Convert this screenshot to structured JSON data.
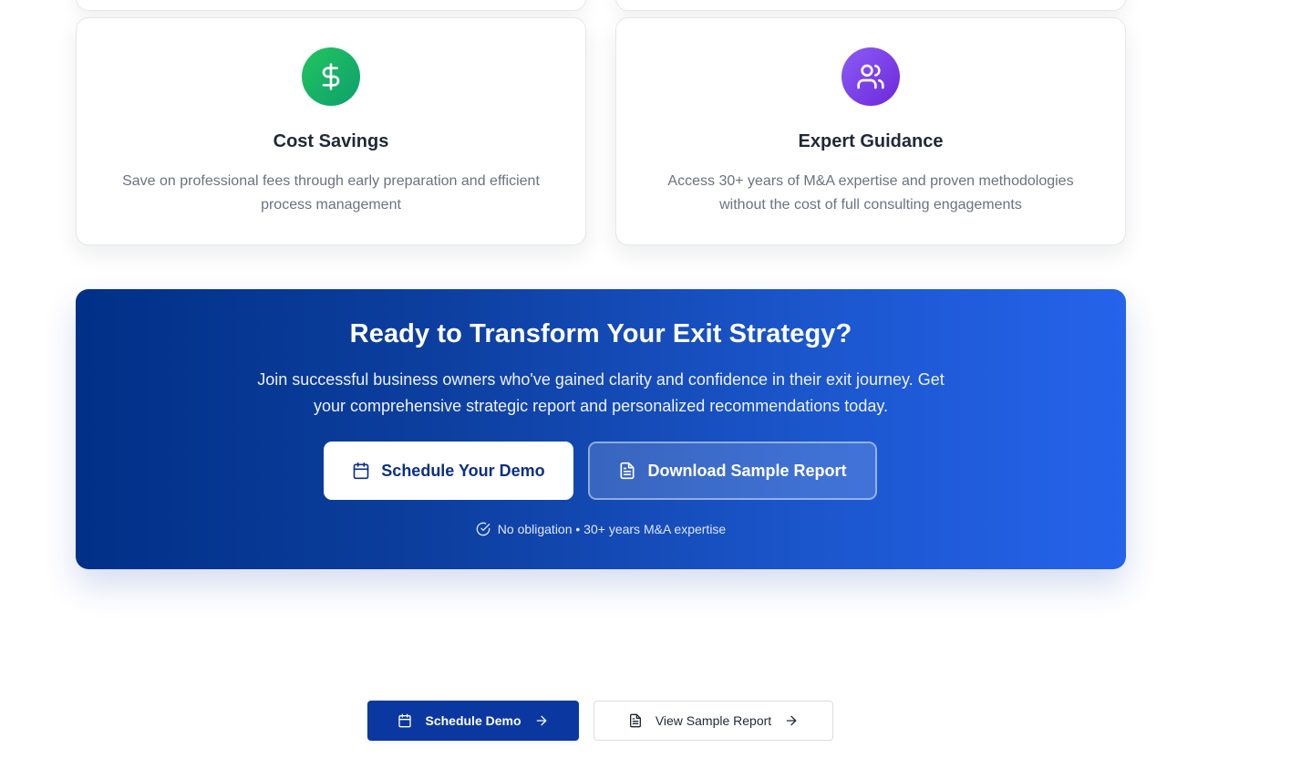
{
  "features": [
    {
      "icon": "dollar-icon",
      "title": "Cost Savings",
      "description": "Save on professional fees through early preparation and efficient process management",
      "color_from": "#22c55e",
      "color_to": "#0d9f6e"
    },
    {
      "icon": "users-icon",
      "title": "Expert Guidance",
      "description": "Access 30+ years of M&A expertise and proven methodologies without the cost of full consulting engagements",
      "color_from": "#8b5cf6",
      "color_to": "#6d28d9"
    }
  ],
  "cta": {
    "title": "Ready to Transform Your Exit Strategy?",
    "subtitle": "Join successful business owners who've gained clarity and confidence in their exit journey. Get your comprehensive strategic report and personalized recommendations today.",
    "primary_button": "Schedule Your Demo",
    "secondary_button": "Download Sample Report",
    "note": "No obligation • 30+ years M&A expertise",
    "gradient_from": "#003087",
    "gradient_to": "#2563eb"
  },
  "bottom_actions": {
    "schedule_label": "Schedule Demo",
    "report_label": "View Sample Report",
    "primary_color": "#0b38a0"
  }
}
